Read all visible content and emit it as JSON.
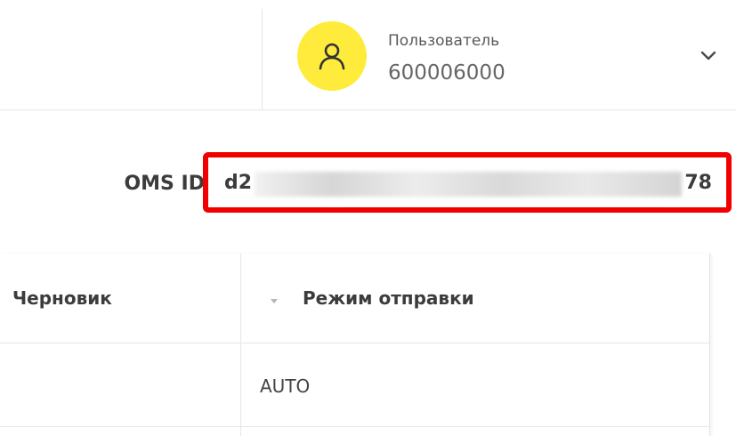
{
  "header": {
    "user": {
      "role_label": "Пользователь",
      "id": "600006000",
      "avatar_color": "#ffeb3b",
      "avatar_icon": "user-icon"
    },
    "dropdown_icon": "chevron-down-icon"
  },
  "oms": {
    "label": "OMS ID",
    "value_visible_start": "d2",
    "value_visible_end": "78",
    "highlight_color": "#f00000"
  },
  "table": {
    "columns": [
      {
        "label": "Черновик"
      },
      {
        "label": "Режим отправки",
        "sort_icon": "sort-down-icon"
      }
    ],
    "rows": [
      [
        "",
        "AUTO"
      ]
    ]
  }
}
